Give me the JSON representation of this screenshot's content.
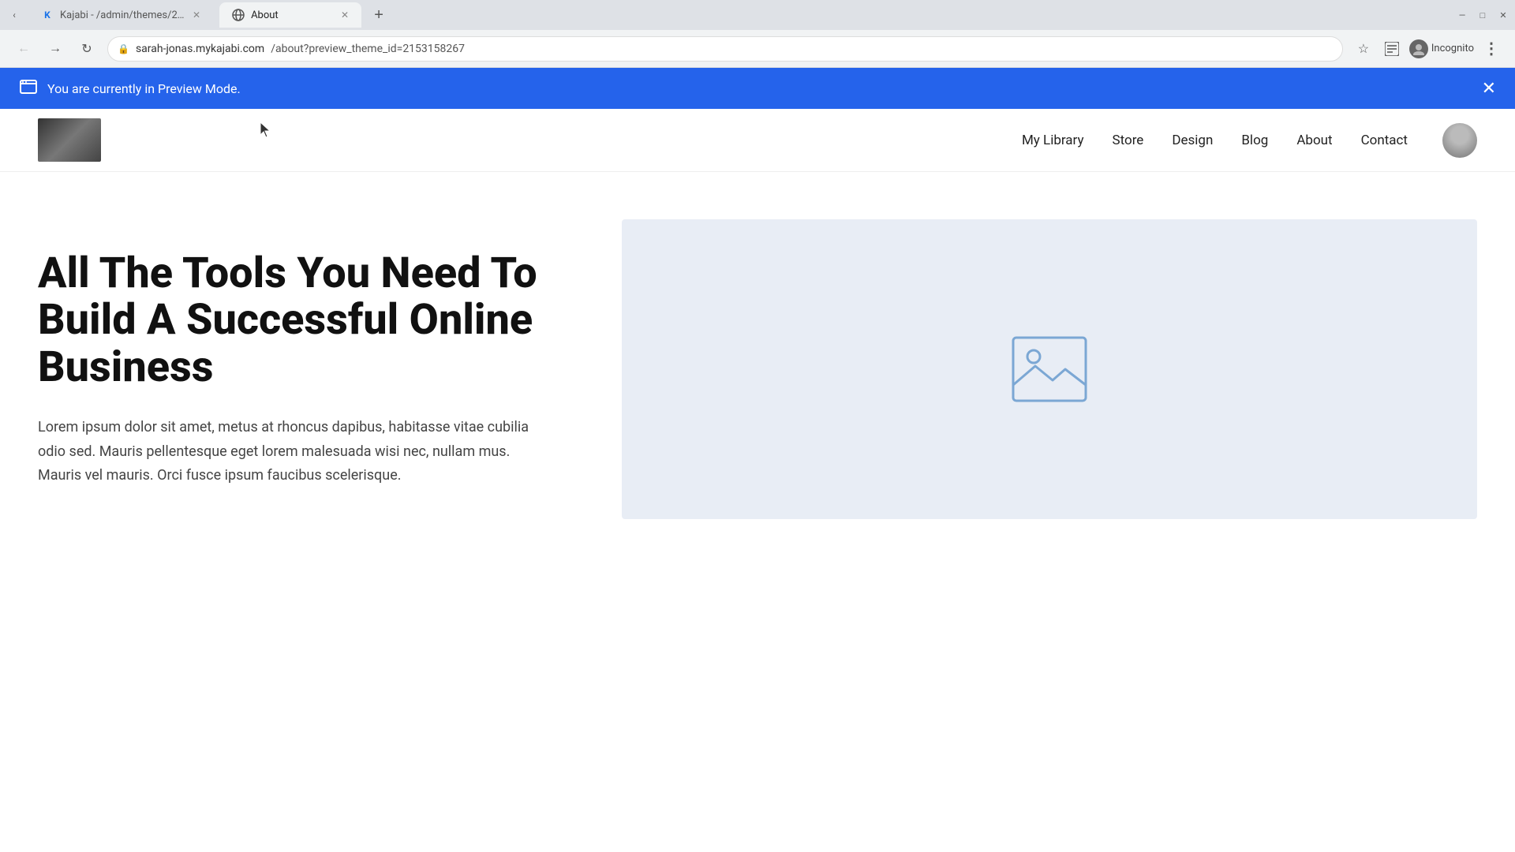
{
  "browser": {
    "tabs": [
      {
        "id": "tab1",
        "favicon": "K",
        "favicon_color": "#1a73e8",
        "label": "Kajabi - /admin/themes/2153158...",
        "active": false,
        "closeable": true
      },
      {
        "id": "tab2",
        "favicon": "🌐",
        "label": "About",
        "active": true,
        "closeable": true
      }
    ],
    "address": {
      "domain": "sarah-jonas.mykajabi.com",
      "path": "/about?preview_theme_id=2153158267"
    },
    "incognito_label": "Incognito"
  },
  "preview_banner": {
    "message": "You are currently in Preview Mode.",
    "close_label": "×"
  },
  "nav": {
    "links": [
      {
        "label": "My Library"
      },
      {
        "label": "Store"
      },
      {
        "label": "Design"
      },
      {
        "label": "Blog"
      },
      {
        "label": "About"
      },
      {
        "label": "Contact"
      }
    ]
  },
  "hero": {
    "title": "All The Tools You Need To Build A Successful Online Business",
    "body": "Lorem ipsum dolor sit amet, metus at rhoncus dapibus, habitasse vitae cubilia odio sed. Mauris pellentesque eget lorem malesuada wisi nec, nullam mus. Mauris vel mauris. Orci fusce ipsum faucibus scelerisque."
  },
  "colors": {
    "preview_banner_bg": "#2563eb",
    "hero_image_bg": "#e8edf5",
    "image_placeholder_stroke": "#7ba7d4"
  }
}
